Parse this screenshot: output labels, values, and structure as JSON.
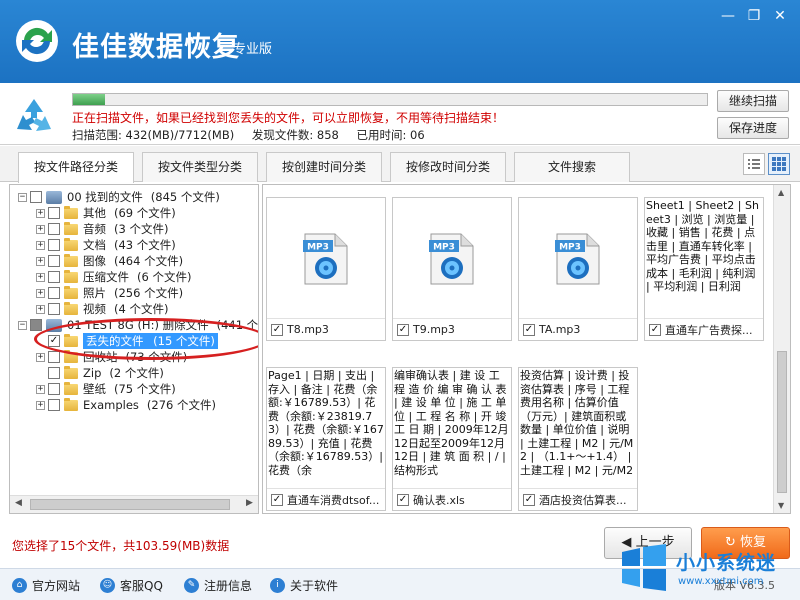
{
  "app": {
    "title": "佳佳数据恢复",
    "edition": "专业版",
    "minimize_label": "—",
    "restore_label": "❐",
    "close_label": "✕"
  },
  "scan": {
    "progress_percent": 5,
    "message": "正在扫描文件，如果已经找到您丢失的文件，可以立即恢复，不用等待扫描结束！",
    "range": "扫描范围: 432(MB)/7712(MB)",
    "found": "发现文件数: 858",
    "elapsed": "已用时间: 06",
    "continue_label": "继续扫描",
    "save_label": "保存进度"
  },
  "tabs": [
    {
      "label": "按文件路径分类"
    },
    {
      "label": "按文件类型分类"
    },
    {
      "label": "按创建时间分类"
    },
    {
      "label": "按修改时间分类"
    },
    {
      "label": "文件搜索"
    }
  ],
  "tree": {
    "root1": {
      "label": "00 找到的文件",
      "count": "(845 个文件)"
    },
    "children1": [
      {
        "label": "其他",
        "count": "(69 个文件)"
      },
      {
        "label": "音频",
        "count": "(3 个文件)"
      },
      {
        "label": "文档",
        "count": "(43 个文件)"
      },
      {
        "label": "图像",
        "count": "(464 个文件)"
      },
      {
        "label": "压缩文件",
        "count": "(6 个文件)"
      },
      {
        "label": "照片",
        "count": "(256 个文件)"
      },
      {
        "label": "视频",
        "count": "(4 个文件)"
      }
    ],
    "root2": {
      "label": "01 TEST 8G (H:) 删除文件",
      "count": "(441 个文"
    },
    "children2": [
      {
        "label": "丢失的文件",
        "count": "(15 个文件)"
      },
      {
        "label": "回收站",
        "count": "(73 个文件)"
      },
      {
        "label": "Zip",
        "count": "(2 个文件)"
      },
      {
        "label": "壁纸",
        "count": "(75 个文件)"
      },
      {
        "label": "Examples",
        "count": "(276 个文件)"
      }
    ]
  },
  "files": [
    {
      "name": "T8.mp3",
      "type": "mp3",
      "icon_label": "MP3"
    },
    {
      "name": "T9.mp3",
      "type": "mp3",
      "icon_label": "MP3"
    },
    {
      "name": "TA.mp3",
      "type": "mp3",
      "icon_label": "MP3"
    },
    {
      "name": "直通车广告费探...",
      "type": "text",
      "preview": "Sheet1 | Sheet2 | Sheet3 | 浏览 | 浏览量 | 收藏 | 销售 | 花费 | 点击里 | 直通车转化率 | 平均广告费 | 平均点击成本 | 毛利润 | 纯利润 | 平均利润 | 日利润"
    },
    {
      "name": "直通车消费dtsof...",
      "type": "text",
      "preview": "Page1 | 日期 | 支出 | 存入 | 备注 | 花费（余额:￥16789.53）| 花费（余额:￥23819.73）| 花费（余额:￥16789.53）| 充值 | 花费（余额:￥16789.53）| 花费（余"
    },
    {
      "name": "确认表.xls",
      "type": "text",
      "preview": "编审确认表 | 建 设 工 程 造 价 编 审 确 认 表 | 建 设 单 位 | 施 工 单 位 | 工 程 名 称 | 开 竣 工 日 期 | 2009年12月12日起至2009年12月12日 | 建 筑 面 积 | / | 结构形式"
    },
    {
      "name": "酒店投资估算表...",
      "type": "text",
      "preview": "投资估算 | 设计费 | 投资估算表 | 序号 | 工程费用名称 | 估算价值（万元）| 建筑面积或数量 | 单位价值 | 说明 | 土建工程 | M2 | 元/M2 | （1.1+～+1.4） | 土建工程 | M2 | 元/M2"
    }
  ],
  "status": {
    "selection": "您选择了15个文件，共103.59(MB)数据",
    "back_label": "上一步",
    "recover_label": "恢复"
  },
  "footer": {
    "links": [
      {
        "label": "官方网站"
      },
      {
        "label": "客服QQ"
      },
      {
        "label": "注册信息"
      },
      {
        "label": "关于软件"
      }
    ],
    "version": "版本 V6.3.5"
  },
  "watermark": {
    "text": "小小系统迷",
    "url": "www.xxxtmi.com"
  },
  "colors": {
    "titlebar": "#1c72c2",
    "progress": "#3ea04f",
    "alert_text": "#d00000",
    "recover_button": "#f06a1a",
    "selection": "#3399ff",
    "annotation": "#d62020"
  }
}
